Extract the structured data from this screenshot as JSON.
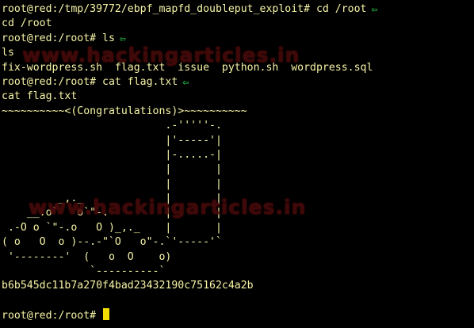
{
  "watermarks": [
    "www.hackingarticles.in",
    "www.hackingarticles.in"
  ],
  "colors": {
    "background": "#000000",
    "text": "#f7f4a6",
    "arrow": "#25c14a",
    "cursor": "#f3dd00",
    "watermark": "#4b0b0b"
  },
  "terminal": {
    "lines": [
      "root@red:/tmp/39772/ebpf_mapfd_doubleput_exploit# cd /root",
      "cd /root",
      "root@red:/root# ls",
      "ls",
      "fix-wordpress.sh  flag.txt  issue  python.sh  wordpress.sql",
      "root@red:/root# cat flag.txt",
      "cat flag.txt",
      "~~~~~~~~~~<(Congratulations)>~~~~~~~~~~",
      "                          .-'''''-.",
      "                          |'-----'|",
      "                          |-.....-|",
      "                          |       |",
      "                          |       |",
      "         _,._             |       |",
      "    __.o`   o`\"-.         |       |",
      " .-O o `\"-.o   O )_,._    |       |",
      "( o   O  o )--.-\"`O   o\"-.`'-----'`",
      " '--------'  (   o  O    o)",
      "              `----------`",
      "b6b545dc11b7a270f4bad23432190c75162c4a2b",
      "",
      "root@red:/root# "
    ],
    "arrow_icon": "arrow-left-icon",
    "arrow_glyph": "⇦"
  }
}
